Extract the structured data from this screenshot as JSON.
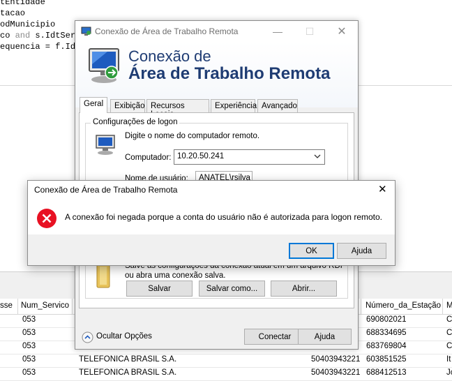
{
  "editor": {
    "lines": [
      "tEntidade",
      "tacao",
      "odMunicipio",
      "co",
      "and",
      "s.IdtServ",
      "equencia = f.Idt"
    ]
  },
  "grid": {
    "columns": [
      "sse",
      "Num_Servico",
      "Número_da_Estação",
      "M"
    ],
    "rows": [
      {
        "num_servico": "053",
        "nome": "",
        "numero": "",
        "estacao": "690802021",
        "m": "C"
      },
      {
        "num_servico": "053",
        "nome": "",
        "numero": "",
        "estacao": "688334695",
        "m": "C"
      },
      {
        "num_servico": "053",
        "nome": "",
        "numero": "",
        "estacao": "683769804",
        "m": "C"
      },
      {
        "num_servico": "053",
        "nome": "TELEFONICA BRASIL S.A.",
        "numero": "50403943221",
        "estacao": "603851525",
        "m": "It"
      },
      {
        "num_servico": "053",
        "nome": "TELEFONICA BRASIL S.A.",
        "numero": "50403943221",
        "estacao": "688412513",
        "m": "Jc"
      }
    ]
  },
  "rdp": {
    "window_title": "Conexão de Área de Trabalho Remota",
    "banner_line1": "Conexão de",
    "banner_line2": "Área de Trabalho Remota",
    "tabs": [
      "Geral",
      "Exibição",
      "Recursos Locais",
      "Experiência",
      "Avançado"
    ],
    "logon_group_title": "Configurações de logon",
    "logon_hint": "Digite o nome do computador remoto.",
    "computer_label": "Computador:",
    "computer_value": "10.20.50.241",
    "username_label": "Nome de usuário:",
    "username_value": "ANATEL\\rsilva",
    "save_hint_line1": "Salve as configurações da conexão atual em um arquivo RDP",
    "save_hint_line2": "ou abra uma conexão salva.",
    "save_button": "Salvar",
    "save_as_button": "Salvar como...",
    "open_button": "Abrir...",
    "hide_options": "Ocultar Opções",
    "connect_button": "Conectar",
    "help_button": "Ajuda"
  },
  "dialog": {
    "title": "Conexão de Área de Trabalho Remota",
    "message": "A conexão foi negada porque a conta do usuário não é autorizada para logon remoto.",
    "ok_button": "OK",
    "help_button": "Ajuda"
  },
  "colors": {
    "accent": "#0078d7",
    "banner_text": "#1f3c73",
    "error_red": "#e81123"
  },
  "icons": [
    "rdp-app-icon",
    "monitor-icon",
    "folder-icon",
    "error-icon",
    "close-icon",
    "minimize-icon",
    "maximize-icon",
    "chevron-down-icon",
    "chevron-up-icon"
  ]
}
